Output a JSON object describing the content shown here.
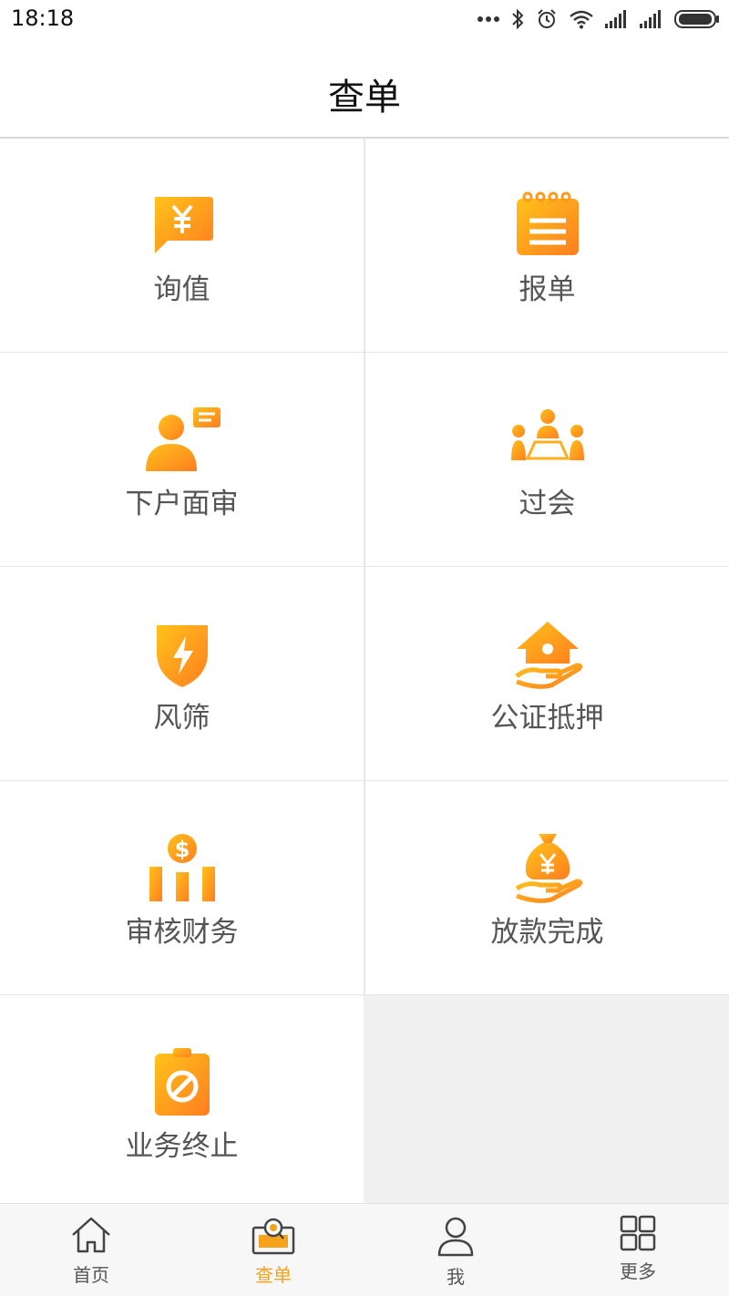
{
  "status_bar": {
    "time": "18:18"
  },
  "header": {
    "title": "查单"
  },
  "grid": {
    "items": [
      {
        "label": "询值",
        "icon": "price-inquiry-icon"
      },
      {
        "label": "报单",
        "icon": "notepad-icon"
      },
      {
        "label": "下户面审",
        "icon": "interview-icon"
      },
      {
        "label": "过会",
        "icon": "meeting-icon"
      },
      {
        "label": "风筛",
        "icon": "risk-shield-icon"
      },
      {
        "label": "公证抵押",
        "icon": "house-mortgage-icon"
      },
      {
        "label": "审核财务",
        "icon": "finance-audit-icon"
      },
      {
        "label": "放款完成",
        "icon": "loan-bag-icon"
      },
      {
        "label": "业务终止",
        "icon": "business-stop-icon"
      }
    ]
  },
  "bottom_nav": {
    "items": [
      {
        "label": "首页",
        "icon": "home-icon",
        "active": false
      },
      {
        "label": "查单",
        "icon": "search-order-icon",
        "active": true
      },
      {
        "label": "我",
        "icon": "user-icon",
        "active": false
      },
      {
        "label": "更多",
        "icon": "grid-more-icon",
        "active": false
      }
    ]
  },
  "colors": {
    "accent_start": "#ffc21a",
    "accent_end": "#ff7e20",
    "nav_active": "#f7a21b"
  }
}
